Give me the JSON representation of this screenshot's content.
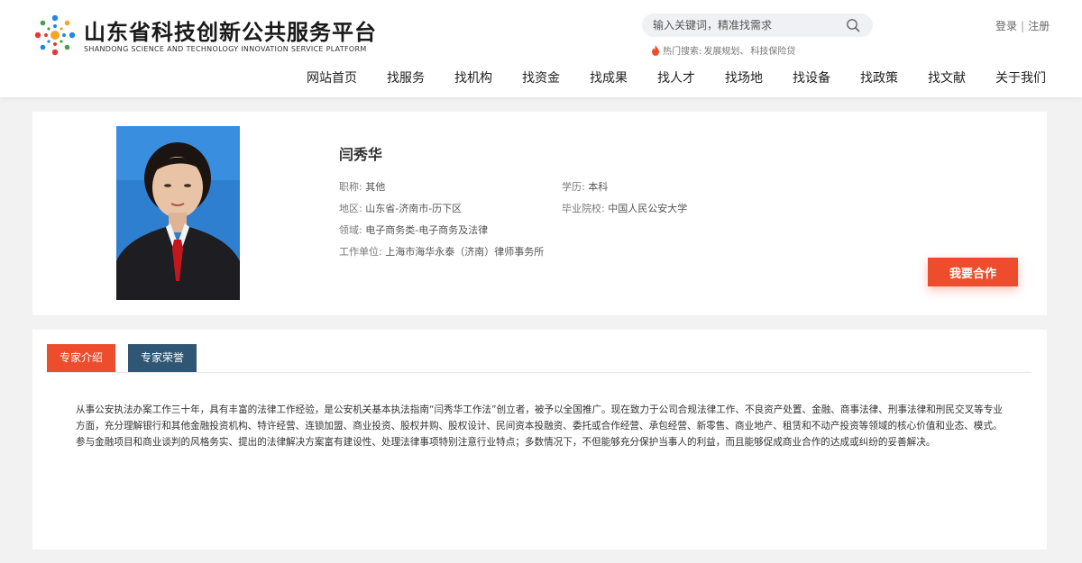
{
  "header": {
    "logo_cn": "山东省科技创新公共服务平台",
    "logo_en": "SHANDONG SCIENCE AND TECHNOLOGY INNOVATION SERVICE PLATFORM",
    "search": {
      "placeholder": "输入关键词，精准找需求"
    },
    "hot_label": "热门搜索:",
    "hot_items": [
      "发展规划、",
      "科技保险贷"
    ],
    "login": "登录",
    "separator": "|",
    "register": "注册",
    "nav": [
      "网站首页",
      "找服务",
      "找机构",
      "找资金",
      "找成果",
      "找人才",
      "找场地",
      "找设备",
      "找政策",
      "找文献",
      "关于我们"
    ]
  },
  "profile": {
    "name": "闫秀华",
    "title_label": "职称:",
    "title_value": "其他",
    "education_label": "学历:",
    "education_value": "本科",
    "region_label": "地区:",
    "region_value": "山东省-济南市-历下区",
    "school_label": "毕业院校:",
    "school_value": "中国人民公安大学",
    "field_label": "领域:",
    "field_value": "电子商务类-电子商务及法律",
    "employer_label": "工作单位:",
    "employer_value": "上海市海华永泰（济南）律师事务所",
    "cooperate_button": "我要合作"
  },
  "detail": {
    "tabs": [
      "专家介绍",
      "专家荣誉"
    ],
    "description": "从事公安执法办案工作三十年，具有丰富的法律工作经验，是公安机关基本执法指南“闫秀华工作法”创立者，被予以全国推广。现在致力于公司合规法律工作、不良资产处置、金融、商事法律、刑事法律和刑民交叉等专业方面，充分理解银行和其他金融投资机构、特许经营、连锁加盟、商业投资、股权并购、股权设计、民间资本投融资、委托或合作经营、承包经营、新零售、商业地产、租赁和不动产投资等领域的核心价值和业态、模式。参与金融项目和商业谈判的风格务实、提出的法律解决方案富有建设性、处理法律事项特别注意行业特点；多数情况下，不但能够充分保护当事人的利益，而且能够促成商业合作的达成或纠纷的妥善解决。"
  },
  "colors": {
    "accent": "#ee4d2d",
    "tab_inactive": "#2f5673",
    "background": "#f2f2f2"
  }
}
